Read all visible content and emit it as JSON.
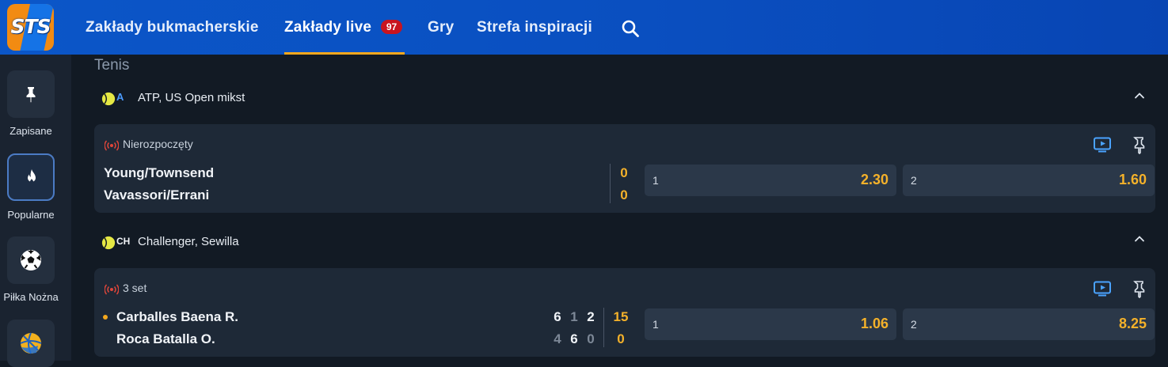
{
  "header": {
    "logo_text": "STS",
    "nav": [
      {
        "label": "Zakłady bukmacherskie"
      },
      {
        "label": "Zakłady live",
        "badge": "97"
      },
      {
        "label": "Gry"
      },
      {
        "label": "Strefa inspiracji"
      }
    ],
    "search_icon": "search-icon",
    "accent_color": "#f6a81e"
  },
  "sidebar": {
    "items": [
      {
        "label": "Zapisane",
        "icon": "pin-icon"
      },
      {
        "label": "Popularne",
        "icon": "flame-icon",
        "active": true
      },
      {
        "label": "Piłka Nożna",
        "icon": "soccer-ball-icon"
      },
      {
        "label": "",
        "icon": "basketball-icon"
      }
    ]
  },
  "main": {
    "sport": "Tenis",
    "leagues": [
      {
        "code": "A",
        "name": "ATP, US Open mikst",
        "match": {
          "status": "Nierozpoczęty",
          "team1": "Young/Townsend",
          "team2": "Vavassori/Errani",
          "points1": "0",
          "points2": "0",
          "odds": [
            {
              "label": "1",
              "value": "2.30"
            },
            {
              "label": "2",
              "value": "1.60"
            }
          ]
        }
      },
      {
        "code": "CH",
        "name": "Challenger, Sewilla",
        "match": {
          "status": "3 set",
          "team1": "Carballes Baena R.",
          "team2": "Roca Batalla O.",
          "sets1": [
            "6",
            "1",
            "2"
          ],
          "sets2": [
            "4",
            "6",
            "0"
          ],
          "points1": "15",
          "points2": "0",
          "odds": [
            {
              "label": "1",
              "value": "1.06"
            },
            {
              "label": "2",
              "value": "8.25"
            }
          ]
        }
      }
    ]
  }
}
